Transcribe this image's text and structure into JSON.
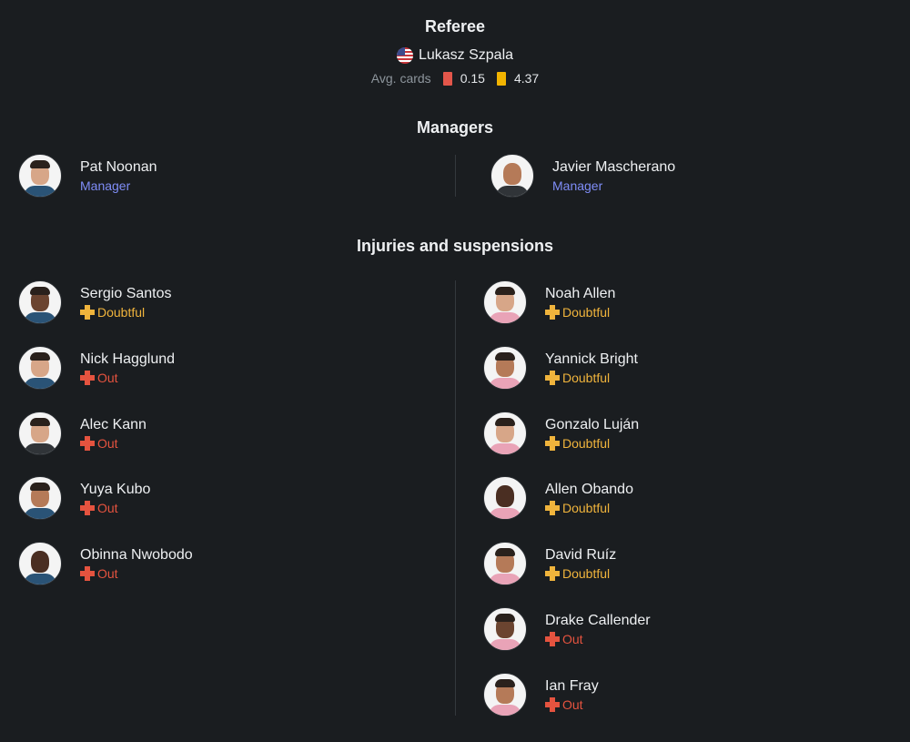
{
  "referee": {
    "title": "Referee",
    "name": "Lukasz Szpala",
    "flag_icon": "us-flag-icon",
    "avg_cards_label": "Avg. cards",
    "red_cards": "0.15",
    "yellow_cards": "4.37"
  },
  "managers": {
    "title": "Managers",
    "home": {
      "name": "Pat Noonan",
      "role": "Manager"
    },
    "away": {
      "name": "Javier Mascherano",
      "role": "Manager"
    }
  },
  "injuries": {
    "title": "Injuries and suspensions",
    "home": [
      {
        "name": "Sergio Santos",
        "status": "Doubtful"
      },
      {
        "name": "Nick Hagglund",
        "status": "Out"
      },
      {
        "name": "Alec Kann",
        "status": "Out"
      },
      {
        "name": "Yuya Kubo",
        "status": "Out"
      },
      {
        "name": "Obinna Nwobodo",
        "status": "Out"
      }
    ],
    "away": [
      {
        "name": "Noah Allen",
        "status": "Doubtful"
      },
      {
        "name": "Yannick Bright",
        "status": "Doubtful"
      },
      {
        "name": "Gonzalo Luján",
        "status": "Doubtful"
      },
      {
        "name": "Allen Obando",
        "status": "Doubtful"
      },
      {
        "name": "David Ruíz",
        "status": "Doubtful"
      },
      {
        "name": "Drake Callender",
        "status": "Out"
      },
      {
        "name": "Ian Fray",
        "status": "Out"
      }
    ]
  },
  "colors": {
    "background": "#1a1d20",
    "manager_role": "#7f8df7",
    "doubtful": "#f0b43c",
    "out": "#e5533f",
    "red_card": "#e3564a",
    "yellow_card": "#f2b400"
  }
}
